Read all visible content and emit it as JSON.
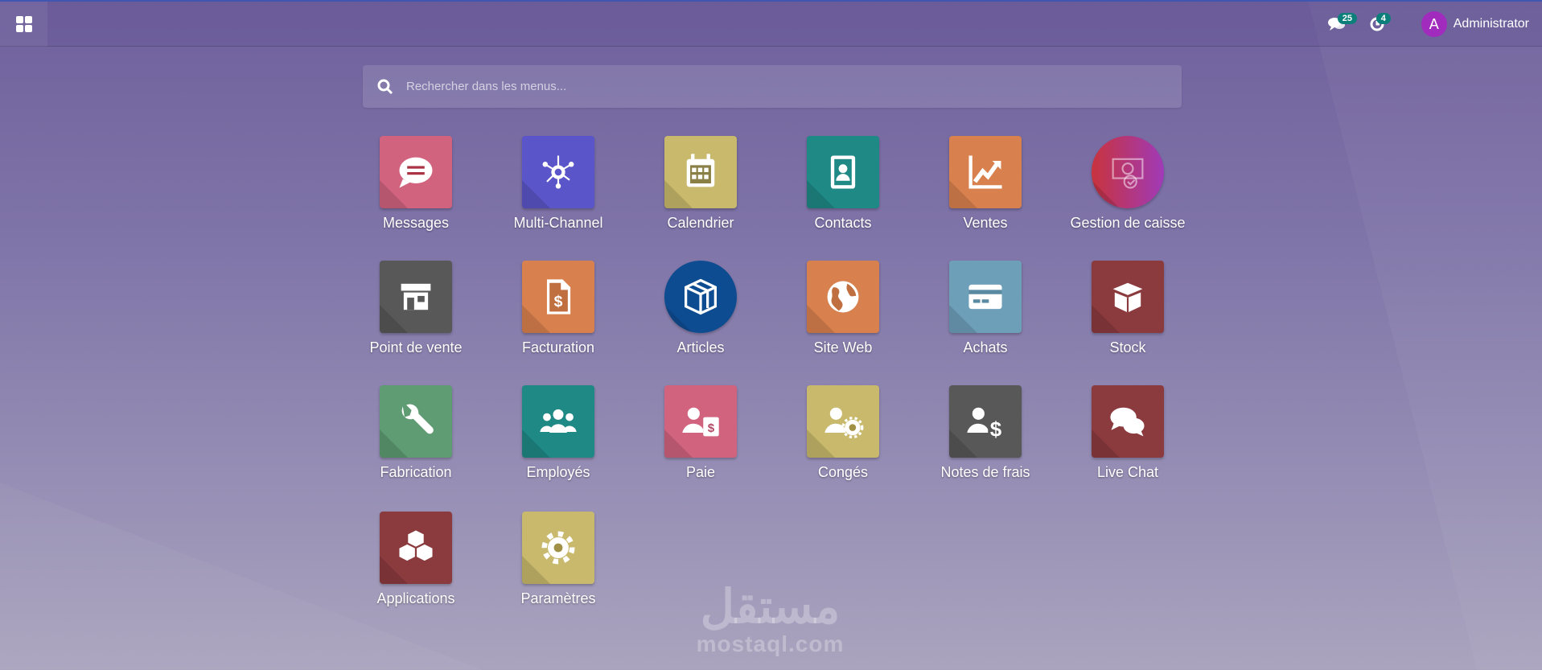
{
  "topbar": {
    "notifications": [
      {
        "icon": "chat-icon",
        "count": "25"
      },
      {
        "icon": "activity-clock-icon",
        "count": "4"
      }
    ],
    "user": {
      "initial": "A",
      "name": "Administrator",
      "avatar_color": "#a12bbd"
    }
  },
  "search": {
    "placeholder": "Rechercher dans les menus...",
    "value": ""
  },
  "apps": [
    {
      "label": "Messages",
      "icon": "chat-bubble-icon",
      "color": "#d1637f"
    },
    {
      "label": "Multi-Channel",
      "icon": "network-hub-icon",
      "color": "#5a55c8"
    },
    {
      "label": "Calendrier",
      "icon": "calendar-icon",
      "color": "#c8b96d"
    },
    {
      "label": "Contacts",
      "icon": "address-book-icon",
      "color": "#1f8985"
    },
    {
      "label": "Ventes",
      "icon": "chart-up-icon",
      "color": "#d8814f"
    },
    {
      "label": "Gestion de caisse",
      "icon": "cash-check-icon",
      "color": "#c0364f",
      "shape": "circle"
    },
    {
      "label": "Point de vente",
      "icon": "store-icon",
      "color": "#585858"
    },
    {
      "label": "Facturation",
      "icon": "invoice-dollar-icon",
      "color": "#d8814f"
    },
    {
      "label": "Articles",
      "icon": "cube-box-icon",
      "color": "#0e4c92",
      "shape": "circle"
    },
    {
      "label": "Site Web",
      "icon": "globe-icon",
      "color": "#d8814f"
    },
    {
      "label": "Achats",
      "icon": "credit-card-icon",
      "color": "#6e9fb9"
    },
    {
      "label": "Stock",
      "icon": "open-box-icon",
      "color": "#8b3b3e"
    },
    {
      "label": "Fabrication",
      "icon": "wrench-icon",
      "color": "#5f9b73"
    },
    {
      "label": "Employés",
      "icon": "users-icon",
      "color": "#1f8985"
    },
    {
      "label": "Paie",
      "icon": "user-payslip-icon",
      "color": "#d1637f"
    },
    {
      "label": "Congés",
      "icon": "user-gear-icon",
      "color": "#c8b96d"
    },
    {
      "label": "Notes de frais",
      "icon": "user-dollar-icon",
      "color": "#585858"
    },
    {
      "label": "Live Chat",
      "icon": "chats-icon",
      "color": "#8b3b3e"
    },
    {
      "label": "Applications",
      "icon": "cubes-icon",
      "color": "#8b3b3e"
    },
    {
      "label": "Paramètres",
      "icon": "gear-icon",
      "color": "#c8b96d"
    }
  ],
  "watermark": {
    "arabic": "مستقل",
    "latin": "mostaql.com"
  }
}
